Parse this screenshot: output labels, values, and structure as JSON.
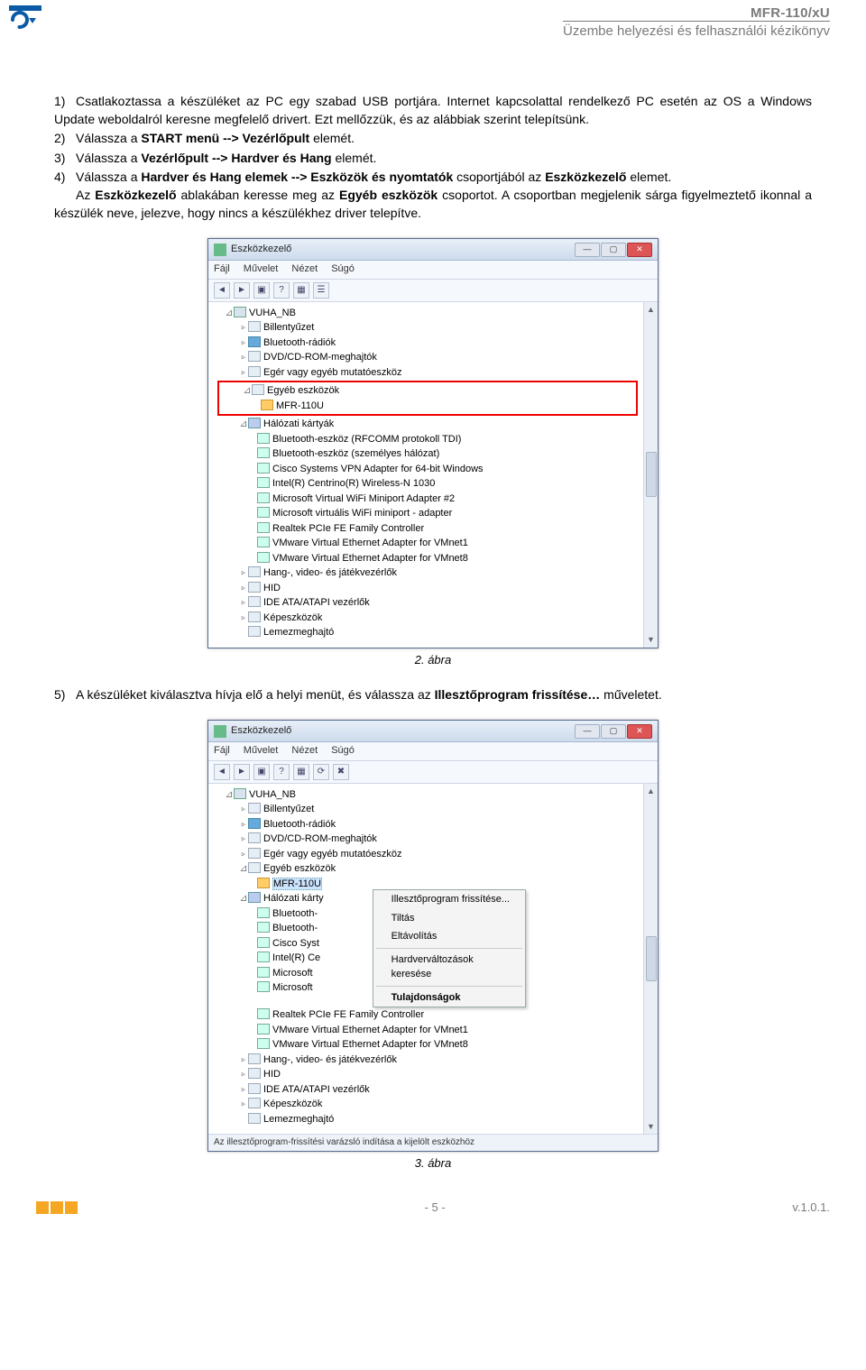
{
  "header": {
    "title": "MFR-110/xU",
    "subtitle": "Üzembe helyezési és felhasználói kézikönyv"
  },
  "steps": {
    "s1_a": "Csatlakoztassa a készüléket az PC egy szabad USB portjára. Internet kapcsolattal rendelkező PC esetén az OS a Windows Update weboldalról keresne megfelelő drivert. Ezt mellőzzük, és az alábbiak szerint telepítsünk.",
    "s2_a": "Válassza a ",
    "s2_b": "START menü --> Vezérlőpult",
    "s2_c": " elemét.",
    "s3_a": "Válassza a ",
    "s3_b": "Vezérlőpult --> Hardver és Hang",
    "s3_c": " elemét.",
    "s4_a": "Válassza a ",
    "s4_b": "Hardver és Hang elemek --> Eszközök és nyomtatók",
    "s4_c": " csoportjából az ",
    "s4_d": "Eszközkezelő",
    "s4_e": " elemet.",
    "s4_f": "Az ",
    "s4_g": "Eszközkezelő",
    "s4_h": " ablakában keresse meg az ",
    "s4_i": "Egyéb eszközök",
    "s4_j": " csoportot. A csoportban megjelenik sárga figyelmeztető ikonnal a készülék neve, jelezve, hogy nincs a készülékhez driver telepítve.",
    "s5_a": "A készüléket kiválasztva hívja elő a helyi menüt, és válassza az ",
    "s5_b": "Illesztőprogram frissítése…",
    "s5_c": " műveletet."
  },
  "captions": {
    "fig2": "2. ábra",
    "fig3": "3. ábra"
  },
  "devmgr": {
    "title": "Eszközkezelő",
    "menu": [
      "Fájl",
      "Művelet",
      "Nézet",
      "Súgó"
    ],
    "root": "VUHA_NB",
    "groups1": [
      "Billentyűzet",
      "Bluetooth-rádiók",
      "DVD/CD-ROM-meghajtók",
      "Egér vagy egyéb mutatóeszköz"
    ],
    "otherGroup": "Egyéb eszközök",
    "otherItem": "MFR-110U",
    "netGroup": "Hálózati kártyák",
    "netItems": [
      "Bluetooth-eszköz (RFCOMM protokoll TDI)",
      "Bluetooth-eszköz (személyes hálózat)",
      "Cisco Systems VPN Adapter for 64-bit Windows",
      "Intel(R) Centrino(R) Wireless-N 1030",
      "Microsoft Virtual WiFi Miniport Adapter #2",
      "Microsoft virtuális WiFi miniport - adapter",
      "Realtek PCIe FE Family Controller",
      "VMware Virtual Ethernet Adapter for VMnet1",
      "VMware Virtual Ethernet Adapter for VMnet8"
    ],
    "groups2": [
      "Hang-, video- és játékvezérlők",
      "HID",
      "IDE ATA/ATAPI vezérlők",
      "Képeszközök",
      "Lemezmeghajtó"
    ],
    "netItemsShort": [
      "Bluetooth-",
      "Bluetooth-",
      "Cisco Syst",
      "Intel(R) Ce",
      "Microsoft",
      "Microsoft"
    ],
    "netItemsTail": [
      "Realtek PCIe FE Family Controller",
      "VMware Virtual Ethernet Adapter for VMnet1",
      "VMware Virtual Ethernet Adapter for VMnet8"
    ]
  },
  "ctx": {
    "items": [
      "Illesztőprogram frissítése...",
      "Tiltás",
      "Eltávolítás",
      "Hardverváltozások keresése",
      "Tulajdonságok"
    ]
  },
  "status": "Az illesztőprogram-frissítési varázsló indítása a kijelölt eszközhöz",
  "footer": {
    "page": "- 5 -",
    "version": "v.1.0.1."
  }
}
